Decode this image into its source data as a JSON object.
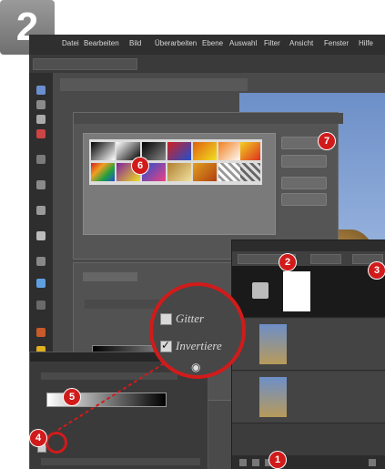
{
  "step": "2",
  "menu": [
    "Datei",
    "Bearbeiten",
    "Bild",
    "Überarbeiten",
    "Ebene",
    "Auswahl",
    "Filter",
    "Ansicht",
    "Fenster",
    "Hilfe"
  ],
  "zoom_labels": {
    "gitter": "Gitter",
    "invert": "Invertiere"
  },
  "markers": [
    "1",
    "2",
    "3",
    "4",
    "5",
    "6",
    "7"
  ],
  "colors": {
    "marker_red": "#d11b1b",
    "ui_dark": "#3b3b3b"
  },
  "gitter_checked": false,
  "invert_checked": true
}
